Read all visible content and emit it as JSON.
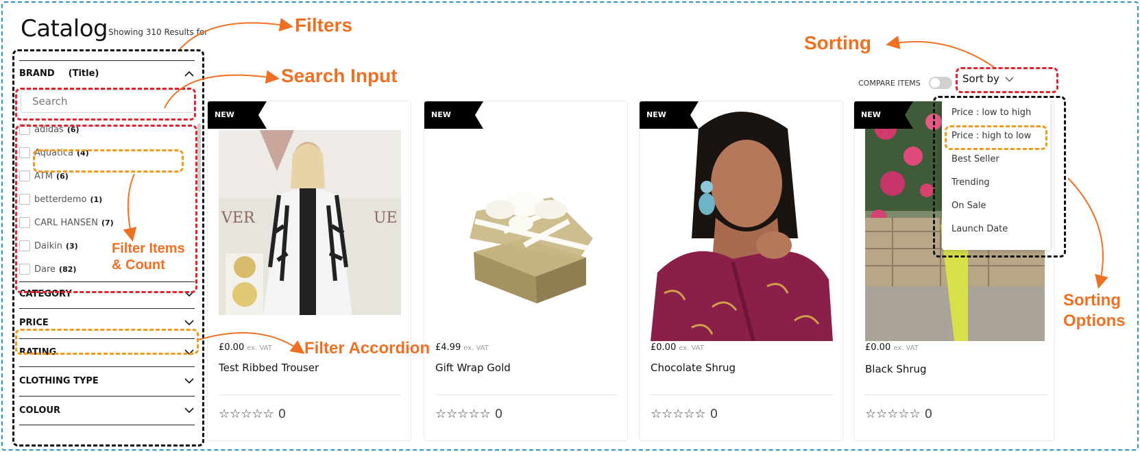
{
  "header": {
    "title": "Catalog",
    "results_text": "Showing 310 Results for"
  },
  "annotations": {
    "filters": "Filters",
    "search_input": "Search Input",
    "filter_items_count_1": "Filter Items",
    "filter_items_count_2": "& Count",
    "filter_accordion": "Filter Accordion",
    "sorting": "Sorting",
    "sorting_options_1": "Sorting",
    "sorting_options_2": "Options",
    "brand_title_tag": "(Title)",
    "accent_color": "#f07023"
  },
  "sidebar": {
    "brand_heading": "BRAND",
    "search_placeholder": "Search",
    "brands": [
      {
        "label": "adidas",
        "count": "(6)"
      },
      {
        "label": "Aquatica",
        "count": "(4)"
      },
      {
        "label": "ATM",
        "count": "(6)"
      },
      {
        "label": "betterdemo",
        "count": "(1)"
      },
      {
        "label": "CARL HANSEN",
        "count": "(7)"
      },
      {
        "label": "Daikin",
        "count": "(3)"
      },
      {
        "label": "Dare",
        "count": "(82)"
      }
    ],
    "accordions": [
      "CATEGORY",
      "PRICE",
      "RATING",
      "CLOTHING TYPE",
      "COLOUR"
    ]
  },
  "toolbar": {
    "compare_label": "COMPARE ITEMS",
    "compare_on": false,
    "sort_label": "Sort by"
  },
  "sort_options": [
    "Price : low to high",
    "Price : high to low",
    "Best Seller",
    "Trending",
    "On Sale",
    "Launch Date"
  ],
  "products": [
    {
      "badge": "NEW",
      "price": "£0.00",
      "vat": "ex. VAT",
      "name": "Test Ribbed Trouser",
      "rating": "0"
    },
    {
      "badge": "NEW",
      "price": "£4.99",
      "vat": "ex. VAT",
      "name": "Gift Wrap Gold",
      "rating": "0"
    },
    {
      "badge": "NEW",
      "price": "£0.00",
      "vat": "ex. VAT",
      "name": "Chocolate Shrug",
      "rating": "0"
    },
    {
      "badge": "NEW",
      "price": "£0.00",
      "vat": "ex. VAT",
      "name": "Black Shrug",
      "rating": "0"
    }
  ]
}
